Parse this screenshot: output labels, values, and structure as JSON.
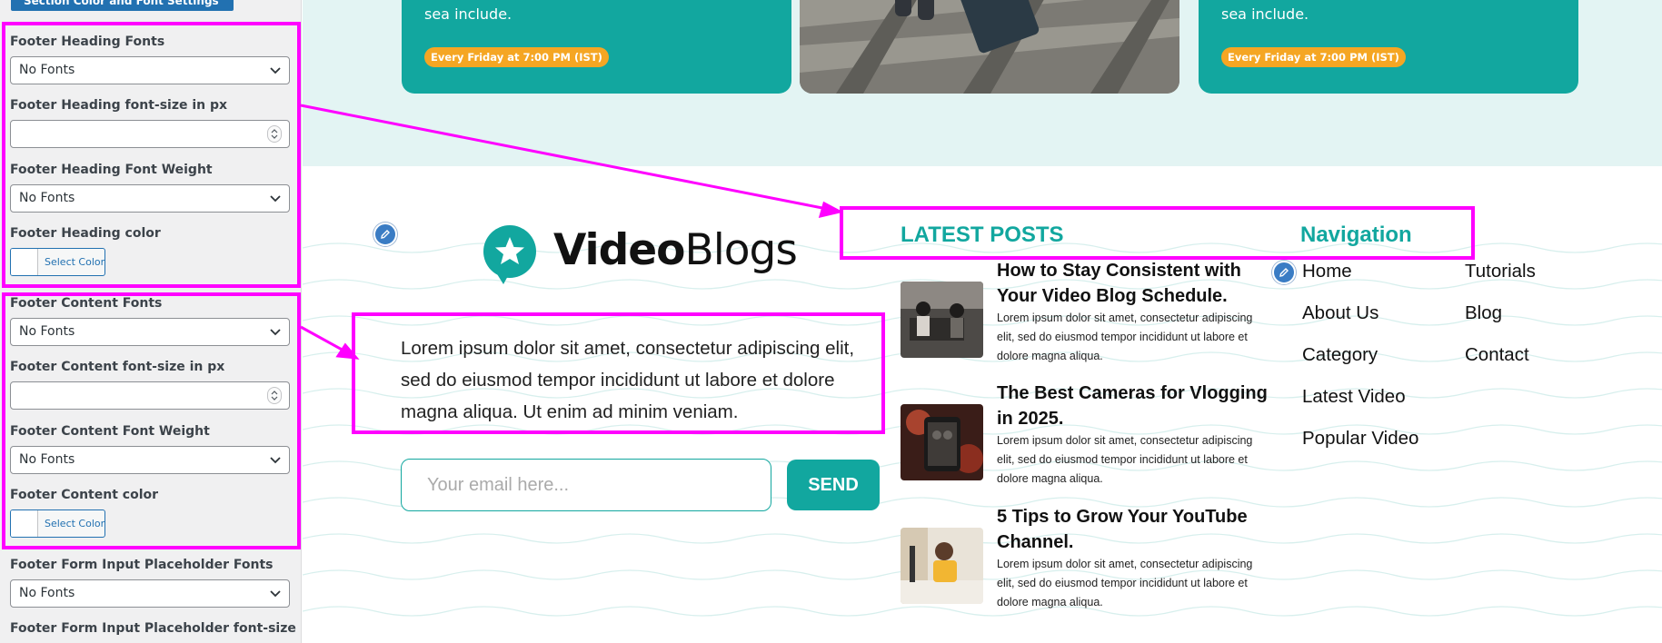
{
  "sidebar": {
    "section_button": "Section Color and Font Settings",
    "fields": [
      {
        "label": "Footer Heading Fonts",
        "type": "select",
        "value": "No Fonts"
      },
      {
        "label": "Footer Heading font-size in px",
        "type": "number",
        "value": ""
      },
      {
        "label": "Footer Heading Font Weight",
        "type": "select",
        "value": "No Fonts"
      },
      {
        "label": "Footer Heading color",
        "type": "color",
        "value": "Select Color"
      },
      {
        "label": "Footer Content Fonts",
        "type": "select",
        "value": "No Fonts"
      },
      {
        "label": "Footer Content font-size in px",
        "type": "number",
        "value": ""
      },
      {
        "label": "Footer Content Font Weight",
        "type": "select",
        "value": "No Fonts"
      },
      {
        "label": "Footer Content color",
        "type": "color",
        "value": "Select Color"
      },
      {
        "label": "Footer Form Input Placeholder Fonts",
        "type": "select",
        "value": "No Fonts"
      },
      {
        "label": "Footer Form Input Placeholder font-size in px",
        "type": "number",
        "value": ""
      }
    ]
  },
  "cards": [
    {
      "text": "sea include.",
      "badge": "Every Friday at 7:00 PM (IST)"
    },
    {
      "text": "sea include.",
      "badge": "Every Friday at 7:00 PM (IST)"
    }
  ],
  "footer": {
    "logo": {
      "part1": "Video",
      "part2": "Blogs"
    },
    "about": "Lorem ipsum dolor sit amet, consectetur adipiscing elit, sed do eiusmod tempor incididunt ut labore et dolore magna aliqua. Ut enim ad minim veniam.",
    "email_placeholder": "Your email here...",
    "send_label": "SEND",
    "latest_posts": {
      "heading": "LATEST POSTS",
      "posts": [
        {
          "title": "How to Stay Consistent with Your Video Blog Schedule.",
          "excerpt": "Lorem ipsum dolor sit amet, consectetur adipiscing elit, sed do eiusmod tempor incididunt ut labore et dolore magna aliqua."
        },
        {
          "title": "The Best Cameras for Vlogging in 2025.",
          "excerpt": "Lorem ipsum dolor sit amet, consectetur adipiscing elit, sed do eiusmod tempor incididunt ut labore et dolore magna aliqua."
        },
        {
          "title": "5 Tips to Grow Your YouTube Channel.",
          "excerpt": "Lorem ipsum dolor sit amet, consectetur adipiscing elit, sed do eiusmod tempor incididunt ut labore et dolore magna aliqua."
        }
      ]
    },
    "navigation": {
      "heading": "Navigation",
      "col1": [
        "Home",
        "About Us",
        "Category",
        "Latest Video",
        "Popular Video"
      ],
      "col2": [
        "Tutorials",
        "Blog",
        "Contact"
      ]
    }
  },
  "colors": {
    "accent": "#12a79f",
    "highlight": "#ff00ff",
    "badge": "#f5a623",
    "admin_blue": "#2271b1"
  },
  "icons": [
    "chevron-down-icon",
    "spinner-arrows-icon",
    "pencil-edit-icon",
    "star-chat-logo-icon"
  ]
}
